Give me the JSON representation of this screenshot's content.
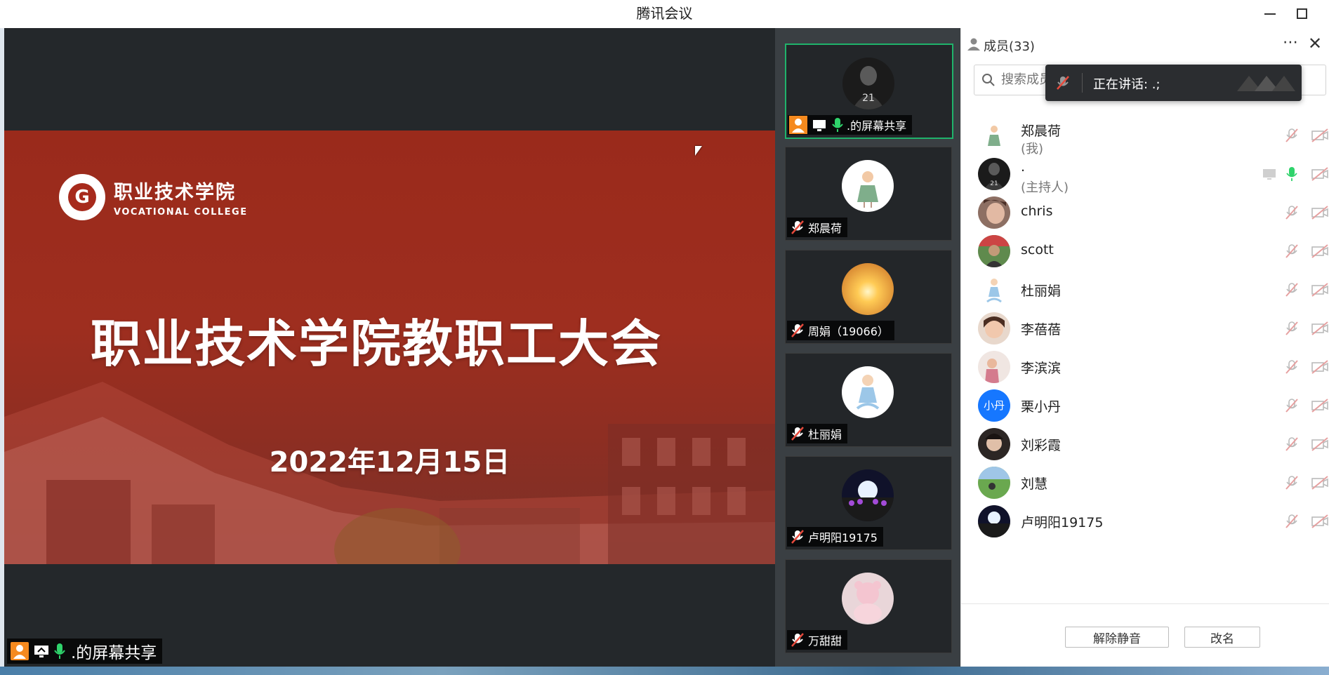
{
  "window": {
    "title": "腾讯会议"
  },
  "slide": {
    "logo_cn": "职业技术学院",
    "logo_en": "VOCATIONAL COLLEGE",
    "logo_seal": "G",
    "headline": "职业技术学院教职工大会",
    "date": "2022年12月15日"
  },
  "share_tag": {
    "label": ".的屏幕共享"
  },
  "videos": [
    {
      "name": ".的屏幕共享",
      "active": true,
      "status": "sharing"
    },
    {
      "name": "郑晨荷",
      "status": "muted"
    },
    {
      "name": "周娟（19066）",
      "status": "muted"
    },
    {
      "name": "杜丽娟",
      "status": "muted"
    },
    {
      "name": "卢明阳19175",
      "status": "muted"
    },
    {
      "name": "万甜甜",
      "status": "muted"
    }
  ],
  "panel": {
    "title": "成员(33)",
    "search_placeholder": "搜索成员",
    "speaking": "正在讲话: .;",
    "members": [
      {
        "name": "郑晨荷",
        "sub": "(我)"
      },
      {
        "name": ".",
        "sub": "(主持人)",
        "host": true
      },
      {
        "name": "chris"
      },
      {
        "name": "scott"
      },
      {
        "name": "杜丽娟"
      },
      {
        "name": "李蓓蓓"
      },
      {
        "name": "李滨滨"
      },
      {
        "name": "栗小丹",
        "initials": "小丹"
      },
      {
        "name": "刘彩霞"
      },
      {
        "name": "刘慧"
      },
      {
        "name": "卢明阳19175"
      }
    ],
    "unmute_label": "解除静音",
    "rename_label": "改名"
  },
  "colors": {
    "accent_green": "#1fb36b",
    "slide_red": "#9a2a1b",
    "avatar_blue": "#1677ff",
    "share_orange": "#f58a1f"
  }
}
